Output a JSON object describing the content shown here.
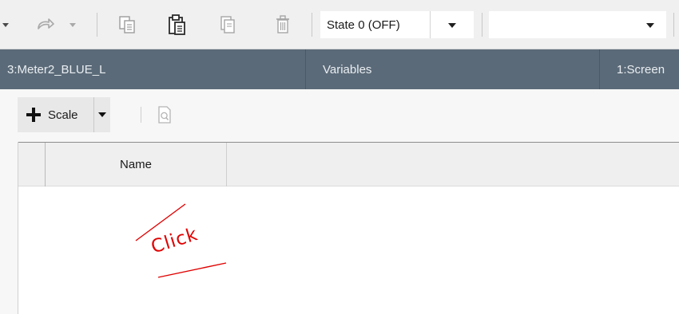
{
  "toolbar": {
    "icons": [
      "dropdown-arrow-icon",
      "redo-icon",
      "dropdown-arrow-icon",
      "copy-icon",
      "paste-icon",
      "duplicate-icon",
      "delete-icon"
    ],
    "state_select": {
      "value": "State 0 (OFF)"
    },
    "second_select": {
      "value": ""
    }
  },
  "tabs": [
    {
      "label": "3:Meter2_BLUE_L"
    },
    {
      "label": "Variables"
    },
    {
      "label": "1:Screen"
    }
  ],
  "panel_toolbar": {
    "add_button_label": "Scale",
    "icons": [
      "plus-icon",
      "dropdown-arrow-icon",
      "preview-icon"
    ]
  },
  "grid": {
    "columns": [
      "Name"
    ],
    "rows": []
  },
  "annotation": {
    "text": "Click",
    "color": "#e00000"
  },
  "colors": {
    "tab_bar": "#5b6a78",
    "tab_text": "#e9eef2",
    "toolbar_bg": "#f0f0f0"
  }
}
